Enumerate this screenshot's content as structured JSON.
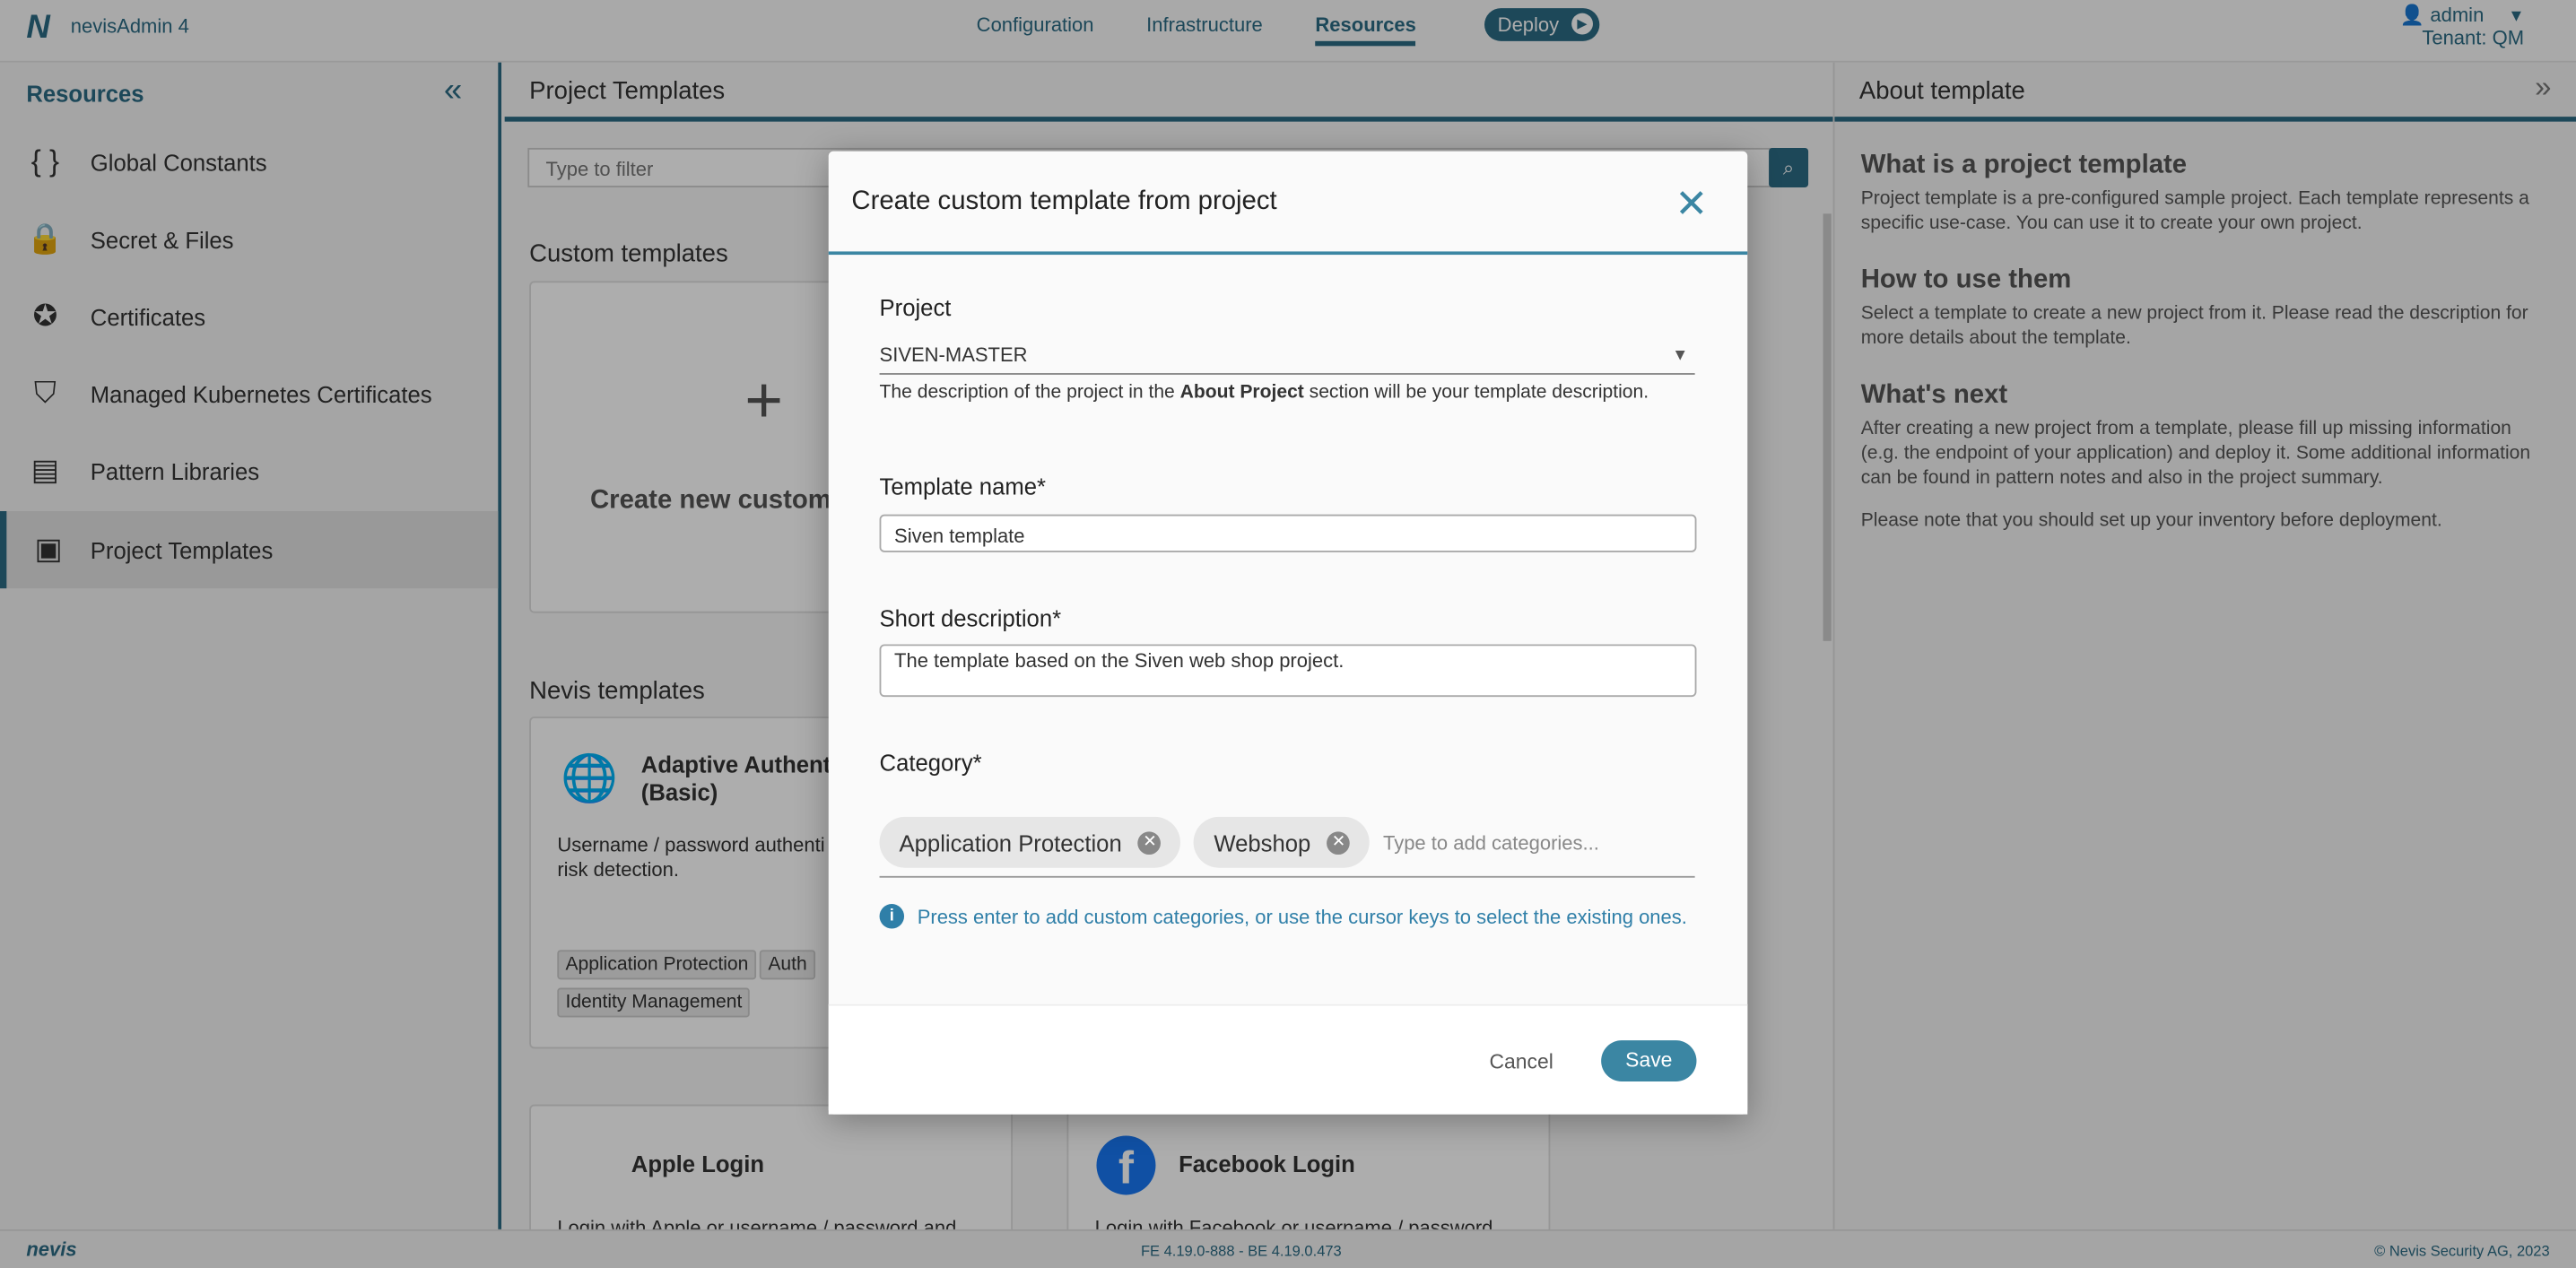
{
  "header": {
    "app_name": "nevisAdmin 4",
    "nav": [
      "Configuration",
      "Infrastructure",
      "Resources"
    ],
    "active_nav": "Resources",
    "deploy": "Deploy",
    "user": "admin",
    "tenant": "Tenant: QM"
  },
  "sidebar": {
    "title": "Resources",
    "items": [
      {
        "label": "Global Constants",
        "icon": "braces-icon"
      },
      {
        "label": "Secret & Files",
        "icon": "lock-icon"
      },
      {
        "label": "Certificates",
        "icon": "badge-check-icon"
      },
      {
        "label": "Managed Kubernetes Certificates",
        "icon": "shield-check-icon"
      },
      {
        "label": "Pattern Libraries",
        "icon": "library-icon"
      },
      {
        "label": "Project Templates",
        "icon": "templates-icon"
      }
    ]
  },
  "main": {
    "title": "Project Templates",
    "filter_placeholder": "Type to filter",
    "custom_section": "Custom templates",
    "create_new": "Create new custom",
    "nevis_section": "Nevis templates",
    "adaptive": {
      "title1": "Adaptive Authent",
      "title2": "(Basic)",
      "desc1": "Username / password authenti",
      "desc2": "risk detection.",
      "tags": [
        "Application Protection",
        "Auth",
        "Identity Management"
      ]
    },
    "apple": {
      "title": "Apple Login",
      "desc": "Login with Apple or username / password and"
    },
    "facebook": {
      "title": "Facebook Login",
      "desc": "Login with Facebook or username / password"
    }
  },
  "about": {
    "title": "About template",
    "sections": [
      {
        "h": "What is a project template",
        "p": "Project template is a pre-configured sample project. Each template represents a specific use-case. You can use it to create your own project."
      },
      {
        "h": "How to use them",
        "p": "Select a template to create a new project from it. Please read the description for more details about the template."
      },
      {
        "h": "What's next",
        "p": "After creating a new project from a template, please fill up missing information (e.g. the endpoint of your application) and deploy it. Some additional information can be found in pattern notes and also in the project summary."
      }
    ],
    "note": "Please note that you should set up your inventory before deployment."
  },
  "footer": {
    "brand": "nevis",
    "version": "FE 4.19.0-888 - BE 4.19.0.473",
    "copyright": "© Nevis Security AG, 2023"
  },
  "modal": {
    "title": "Create custom template from project",
    "project_label": "Project",
    "project_value": "SIVEN-MASTER",
    "hint_pre": "The description of the project in the ",
    "hint_bold": "About Project",
    "hint_post": " section will be your template description.",
    "name_label": "Template name*",
    "name_value": "Siven template",
    "desc_label": "Short description*",
    "desc_value": "The template based on the Siven web shop project.",
    "category_label": "Category*",
    "categories": [
      "Application Protection",
      "Webshop"
    ],
    "category_placeholder": "Type to add categories...",
    "info": "Press enter to add custom categories, or use the cursor keys to select the existing ones.",
    "cancel": "Cancel",
    "save": "Save"
  }
}
